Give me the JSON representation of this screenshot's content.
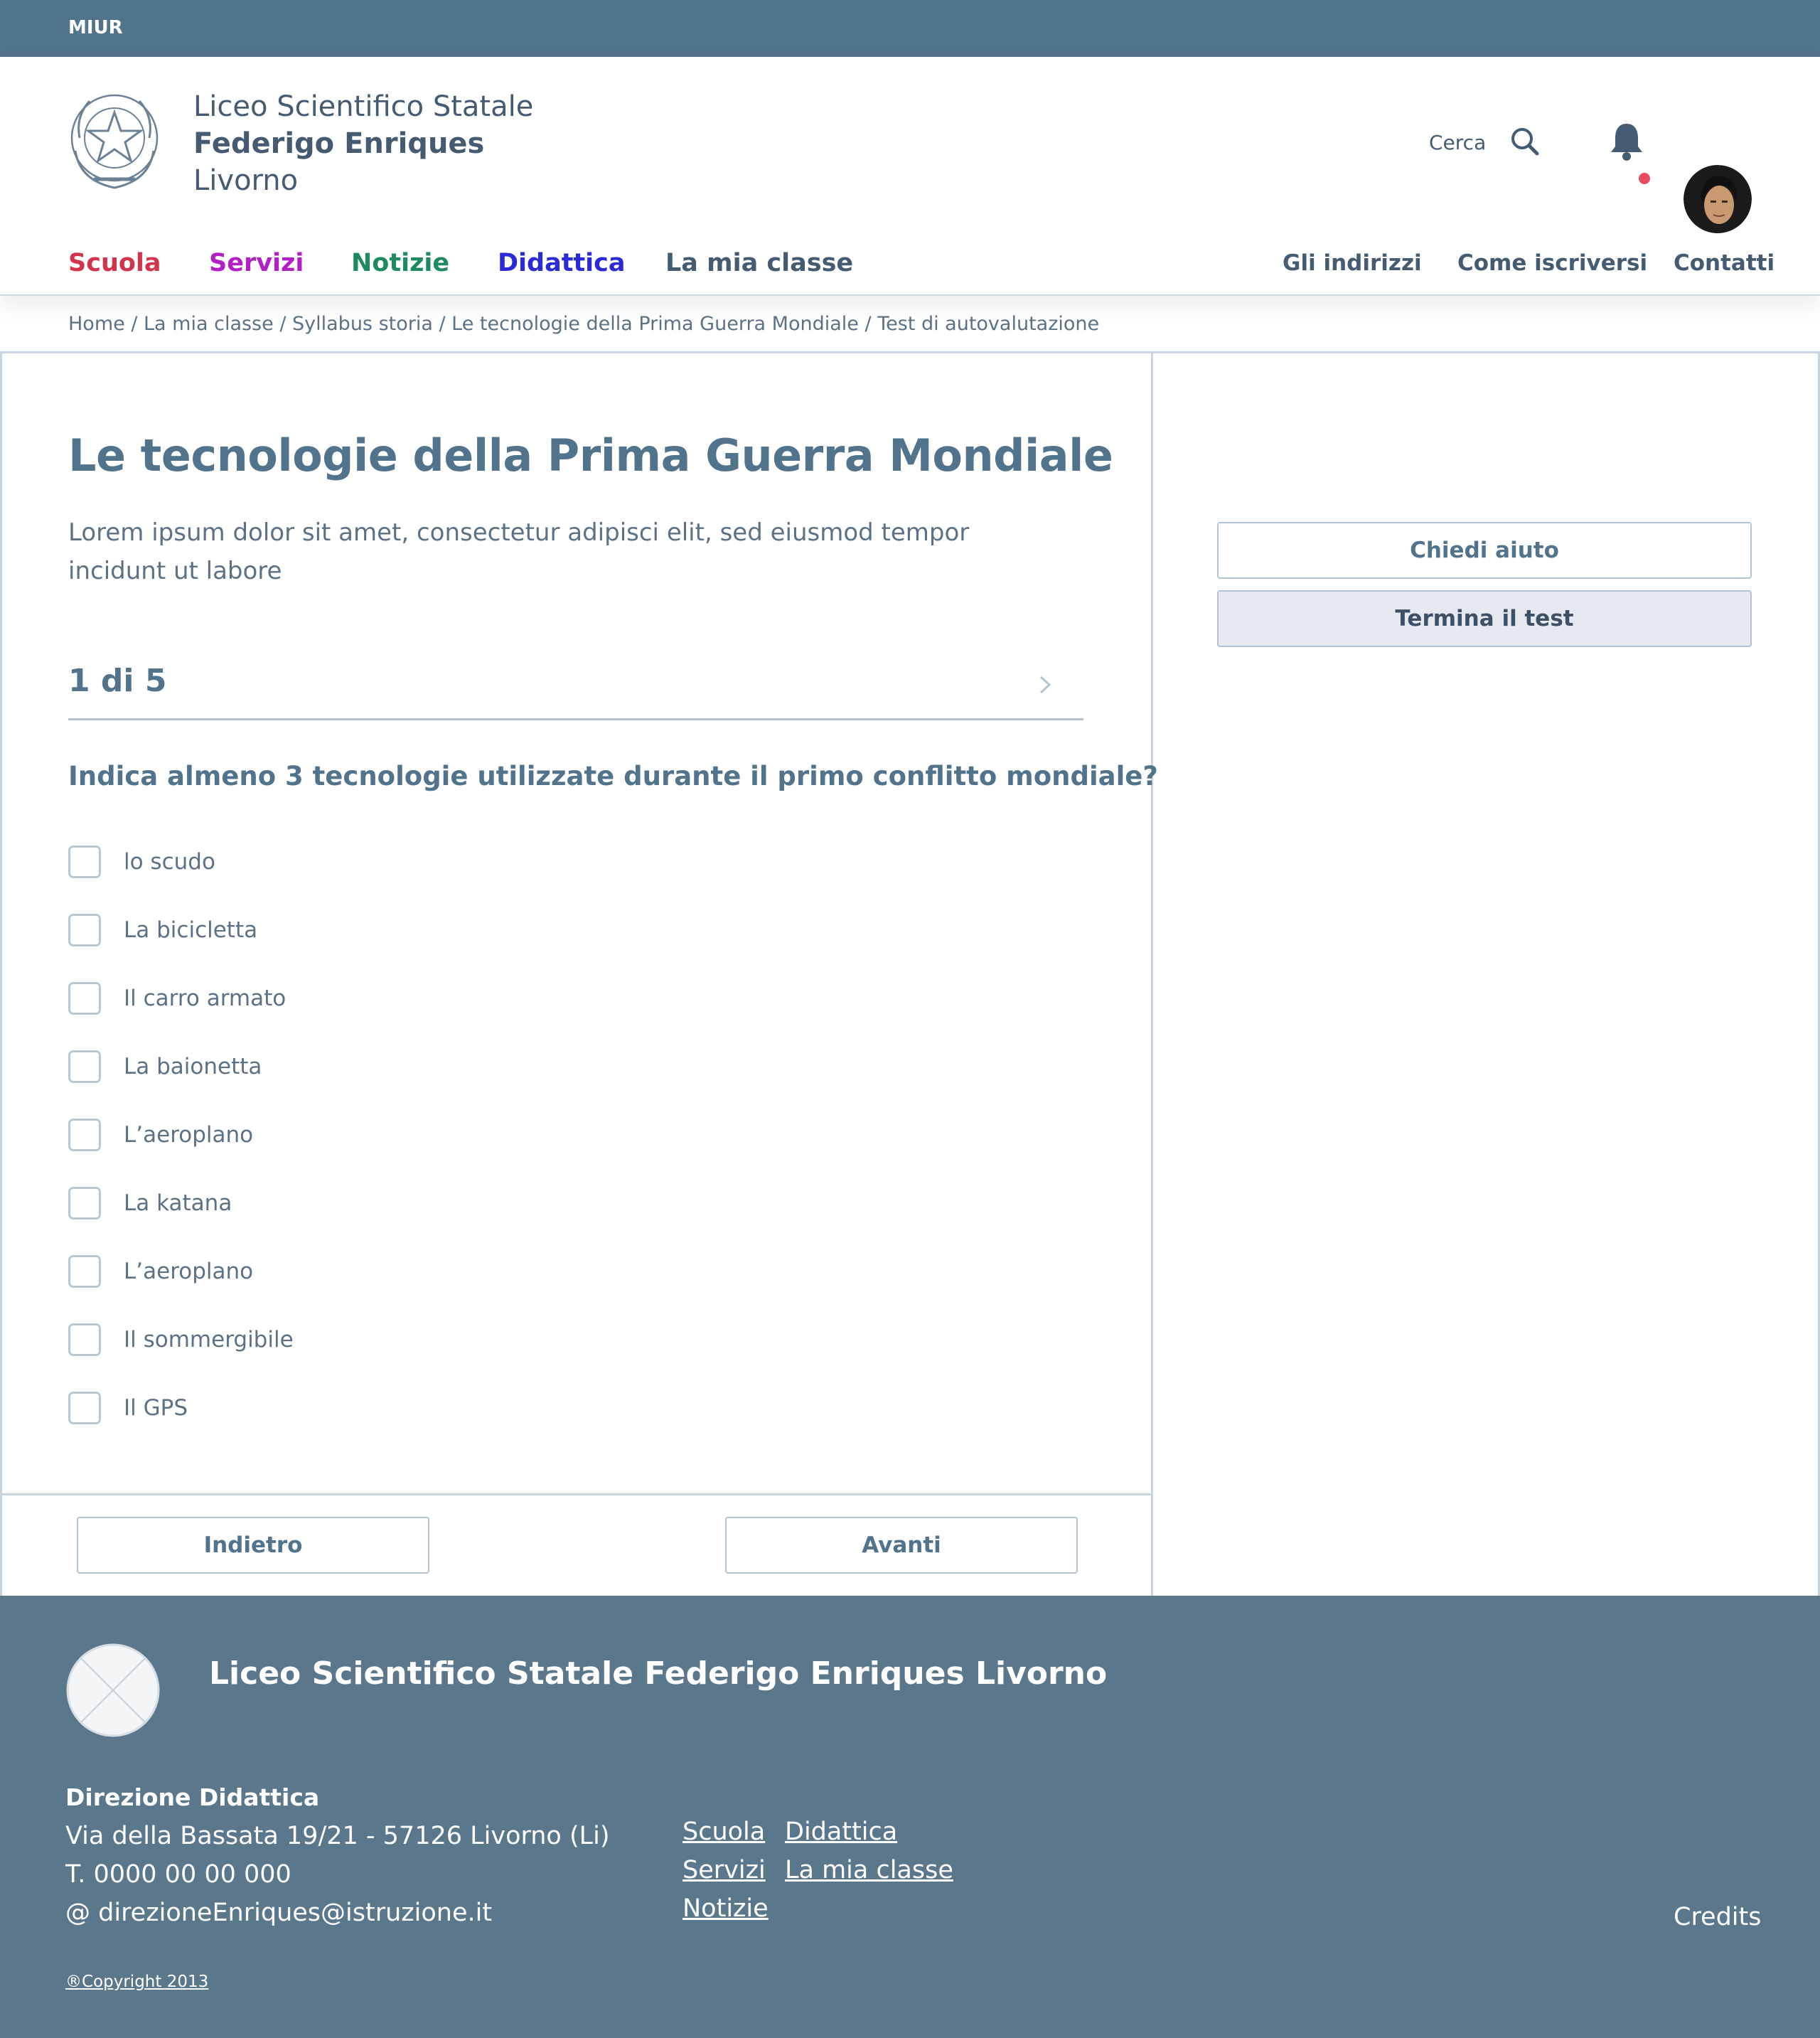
{
  "topbar": {
    "label": "MIUR"
  },
  "header": {
    "school_line1": "Liceo Scientifico Statale",
    "school_line2": "Federigo Enriques",
    "school_line3": "Livorno",
    "search_label": "Cerca",
    "emblem_icon": "emblem-icon",
    "search_icon": "search-icon",
    "bell_icon": "bell-icon",
    "notification_color": "#e84a5f"
  },
  "nav": {
    "main": [
      {
        "label": "Scuola",
        "color": "#d1344c"
      },
      {
        "label": "Servizi",
        "color": "#b020c4"
      },
      {
        "label": "Notizie",
        "color": "#1e8a60"
      },
      {
        "label": "Didattica",
        "color": "#2a2ad8"
      },
      {
        "label": "La mia classe",
        "color": "#455b71"
      }
    ],
    "secondary": [
      "Gli indirizzi",
      "Come iscriversi",
      "Contatti"
    ]
  },
  "breadcrumb": [
    "Home",
    "La mia classe",
    "Syllabus storia",
    "Le tecnologie della Prima Guerra Mondiale",
    "Test di autovalutazione"
  ],
  "main": {
    "title": "Le tecnologie della Prima Guerra Mondiale",
    "description": "Lorem ipsum dolor sit amet, consectetur adipisci elit, sed eiusmod tempor incidunt ut labore",
    "step": "1 di 5",
    "question": "Indica almeno 3 tecnologie utilizzate durante il primo conflitto mondiale?",
    "options": [
      "lo scudo",
      "La bicicletta",
      "Il carro armato",
      "La baionetta",
      "L’aeroplano",
      "La katana",
      "L’aeroplano",
      "Il sommergibile",
      "Il GPS"
    ],
    "back_label": "Indietro",
    "next_label": "Avanti"
  },
  "sidebar": {
    "help_label": "Chiedi aiuto",
    "end_label": "Termina il test"
  },
  "footer": {
    "title": "Liceo Scientifico Statale Federigo Enriques Livorno",
    "dept_title": "Direzione Didattica",
    "address": "Via della Bassata 19/21 - 57126 Livorno (Li)",
    "phone": "T. 0000 00 00 000",
    "email": "@ direzioneEnriques@istruzione.it",
    "links_col1": [
      "Scuola",
      "Servizi",
      "Notizie"
    ],
    "links_col2": [
      "Didattica",
      "La mia classe"
    ],
    "credits": "Credits",
    "copyright": "®Copyright 2013"
  }
}
